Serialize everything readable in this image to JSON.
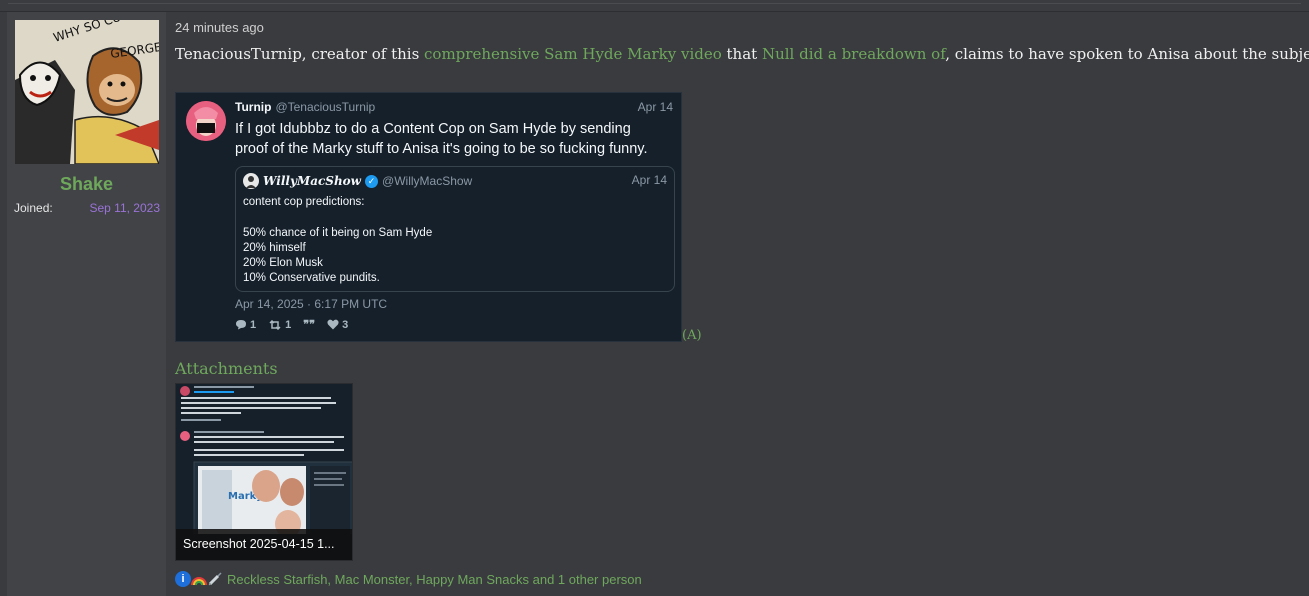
{
  "user": {
    "username": "Shake",
    "joined_label": "Joined:",
    "joined_date": "Sep 11, 2023",
    "avatar_text": "WHY SO CURIOUS, GEORGE?"
  },
  "post": {
    "time": "24 minutes ago",
    "text_before_link1": "TenaciousTurnip, creator of this ",
    "link1": "comprehensive Sam Hyde Marky video",
    "text_between": " that ",
    "link2": "Null did a breakdown of",
    "text_after": ", claims to have spoken to Anisa about the subject",
    "archive_link": "(A)"
  },
  "tweet": {
    "name": "Turnip",
    "handle": "@TenaciousTurnip",
    "date": "Apr 14",
    "text": "If I got Idubbbz to do a Content Cop on Sam Hyde by sending proof of the Marky stuff to Anisa it's going to be so fucking funny.",
    "timestamp": "Apr 14, 2025 · 6:17 PM UTC",
    "replies": "1",
    "retweets": "1",
    "quotes_icon": "❞❞",
    "likes": "3",
    "quote": {
      "name": "WillyMacShow",
      "handle": "@WillyMacShow",
      "date": "Apr 14",
      "body": "content cop predictions:\n\n50% chance of it being on Sam Hyde\n20% himself\n20% Elon Musk\n10% Conservative pundits."
    }
  },
  "attachments": {
    "title": "Attachments",
    "items": [
      {
        "caption": "Screenshot 2025-04-15 1...",
        "thumb_label": "Marky"
      }
    ]
  },
  "reactions": {
    "text": "Reckless Starfish, Mac Monster, Happy Man Snacks and 1 other person",
    "icons": [
      "info-icon",
      "rainbow-icon",
      "syringe-icon"
    ]
  },
  "colors": {
    "accent_green": "#6ea85b",
    "joined_purple": "#9a73d6",
    "tweet_bg": "#15202b",
    "page_bg": "#393b3f"
  }
}
